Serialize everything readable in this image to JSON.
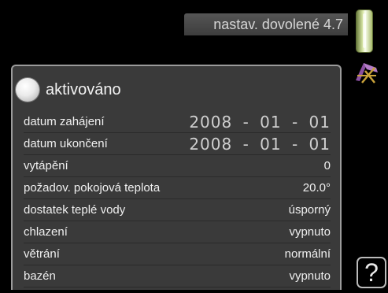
{
  "header": {
    "title": "nastav. dovolené 4.7"
  },
  "status": {
    "label": "aktivováno"
  },
  "settings": {
    "rows": [
      {
        "label": "datum zahájení",
        "value": "2008 - 01 - 01"
      },
      {
        "label": "datum ukončení",
        "value": "2008 - 01 - 01"
      },
      {
        "label": "vytápění",
        "value": "0"
      },
      {
        "label": "požadov. pokojová teplota",
        "value": "20.0°"
      },
      {
        "label": "dostatek teplé vody",
        "value": "úsporný"
      },
      {
        "label": "chlazení",
        "value": "vypnuto"
      },
      {
        "label": "větrání",
        "value": "normální"
      },
      {
        "label": "bazén",
        "value": "vypnuto"
      }
    ]
  },
  "help": {
    "label": "?"
  },
  "icons": {
    "thermometer": "thermometer-icon",
    "vacation": "deck-chair-icon"
  },
  "colors": {
    "background": "#000000",
    "panel": "#3a3a3a",
    "title_tab": "#4a4a4a",
    "thermometer": "#d8e7a6",
    "chair": "#8a4fa0"
  }
}
